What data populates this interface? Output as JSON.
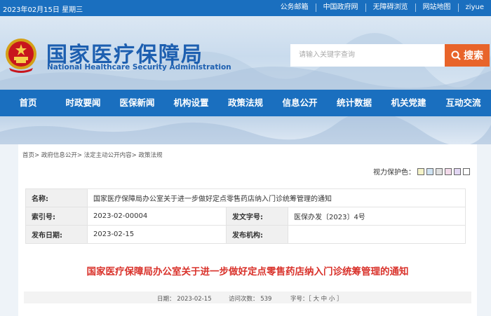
{
  "topbar": {
    "date": "2023年02月15日 星期三",
    "links": [
      "公务邮箱",
      "中国政府网",
      "无障碍浏览",
      "网站地图",
      "ziyue"
    ]
  },
  "header": {
    "title_cn": "国家医疗保障局",
    "title_en": "National Healthcare Security Administration",
    "search_placeholder": "请输入关键字查询",
    "search_button": "搜索"
  },
  "nav": [
    "首页",
    "时政要闻",
    "医保新闻",
    "机构设置",
    "政策法规",
    "信息公开",
    "统计数据",
    "机关党建",
    "互动交流"
  ],
  "breadcrumb": "首页> 政府信息公开> 法定主动公开内容> 政策法规",
  "vision": {
    "label": "视力保护色：",
    "colors": [
      "#f5f3c8",
      "#cfe3f3",
      "#e0e0e0",
      "#f3d9ea",
      "#e2d6f3",
      "#ffffff"
    ]
  },
  "meta": {
    "name_label": "名称:",
    "name_value": "国家医疗保障局办公室关于进一步做好定点零售药店纳入门诊统筹管理的通知",
    "index_label": "索引号:",
    "index_value": "2023-02-00004",
    "docno_label": "发文字号:",
    "docno_value": "医保办发〔2023〕4号",
    "pubdate_label": "发布日期:",
    "pubdate_value": "2023-02-15",
    "org_label": "发布机构:",
    "org_value": ""
  },
  "doc_title": "国家医疗保障局办公室关于进一步做好定点零售药店纳入门诊统筹管理的通知",
  "info": {
    "date": "日期：  2023-02-15",
    "views": "访问次数：   539",
    "fontsize": "字号：［ 大 中 小 ］"
  }
}
